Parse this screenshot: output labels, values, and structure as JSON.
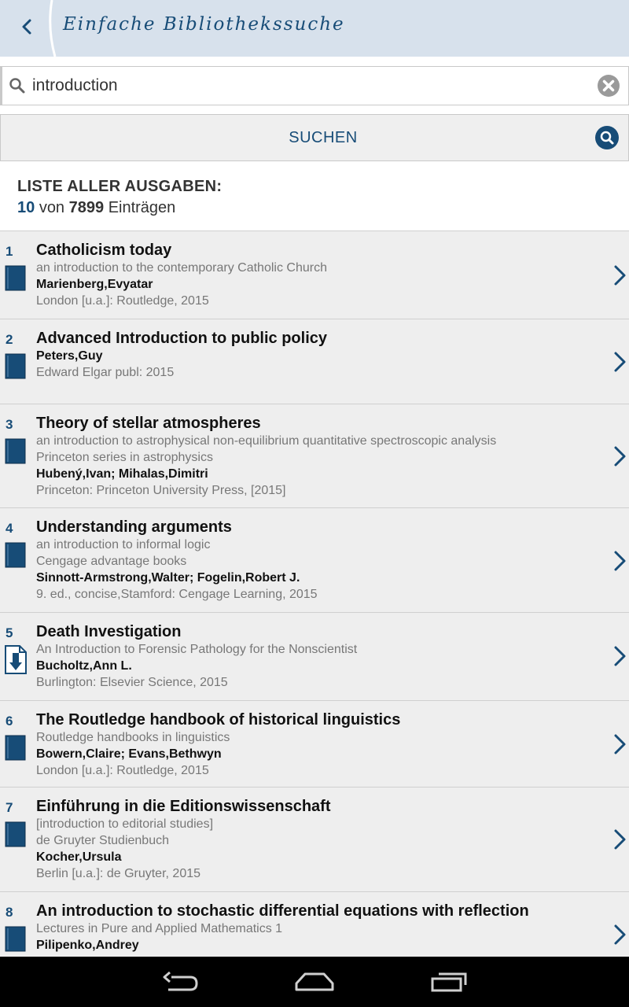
{
  "header": {
    "title": "Einfache Bibliothekssuche"
  },
  "search": {
    "value": "introduction"
  },
  "suchen_label": "SUCHEN",
  "summary": {
    "heading": "LISTE ALLER AUSGABEN:",
    "shown": "10",
    "of_text": "von",
    "total": "7899",
    "entries_text": "Einträgen"
  },
  "results": [
    {
      "num": "1",
      "media": "book",
      "title": "Catholicism today",
      "sub1": "an introduction to the contemporary Catholic Church",
      "sub2": "",
      "author": "Marienberg,Evyatar",
      "pub": "London [u.a.]: Routledge, 2015"
    },
    {
      "num": "2",
      "media": "book",
      "title": "Advanced Introduction to public policy",
      "sub1": "",
      "sub2": "",
      "author": "Peters,Guy",
      "pub": "Edward Elgar publ: 2015"
    },
    {
      "num": "3",
      "media": "book",
      "title": "Theory of stellar atmospheres",
      "sub1": "an introduction to astrophysical non-equilibrium quantitative spectroscopic analysis",
      "sub2": "Princeton series in astrophysics",
      "author": "Hubený,Ivan; Mihalas,Dimitri",
      "pub": "Princeton: Princeton University Press, [2015]"
    },
    {
      "num": "4",
      "media": "book",
      "title": "Understanding arguments",
      "sub1": "an introduction to informal logic",
      "sub2": "Cengage advantage books",
      "author": "Sinnott-Armstrong,Walter; Fogelin,Robert J.",
      "pub": "9. ed., concise,Stamford: Cengage Learning, 2015"
    },
    {
      "num": "5",
      "media": "ebook",
      "title": "Death Investigation",
      "sub1": "An Introduction to Forensic Pathology for the Nonscientist",
      "sub2": "",
      "author": "Bucholtz,Ann L.",
      "pub": "Burlington: Elsevier Science, 2015"
    },
    {
      "num": "6",
      "media": "book",
      "title": "The Routledge handbook of historical linguistics",
      "sub1": "Routledge handbooks in linguistics",
      "sub2": "",
      "author": "Bowern,Claire; Evans,Bethwyn",
      "pub": "London [u.a.]: Routledge, 2015"
    },
    {
      "num": "7",
      "media": "book",
      "title": "Einführung in die Editionswissenschaft",
      "sub1": "[introduction to editorial studies]",
      "sub2": "de Gruyter Studienbuch",
      "author": "Kocher,Ursula",
      "pub": "Berlin [u.a.]: de Gruyter, 2015"
    },
    {
      "num": "8",
      "media": "book",
      "title": "An introduction to stochastic differential equations with reflection",
      "sub1": "Lectures in Pure and Applied Mathematics 1",
      "sub2": "",
      "author": "Pilipenko,Andrey",
      "pub": ""
    }
  ],
  "colors": {
    "accent": "#174c77",
    "header_bg": "#d7e1ec",
    "row_bg": "#eeeeee",
    "subtext": "#777777"
  }
}
